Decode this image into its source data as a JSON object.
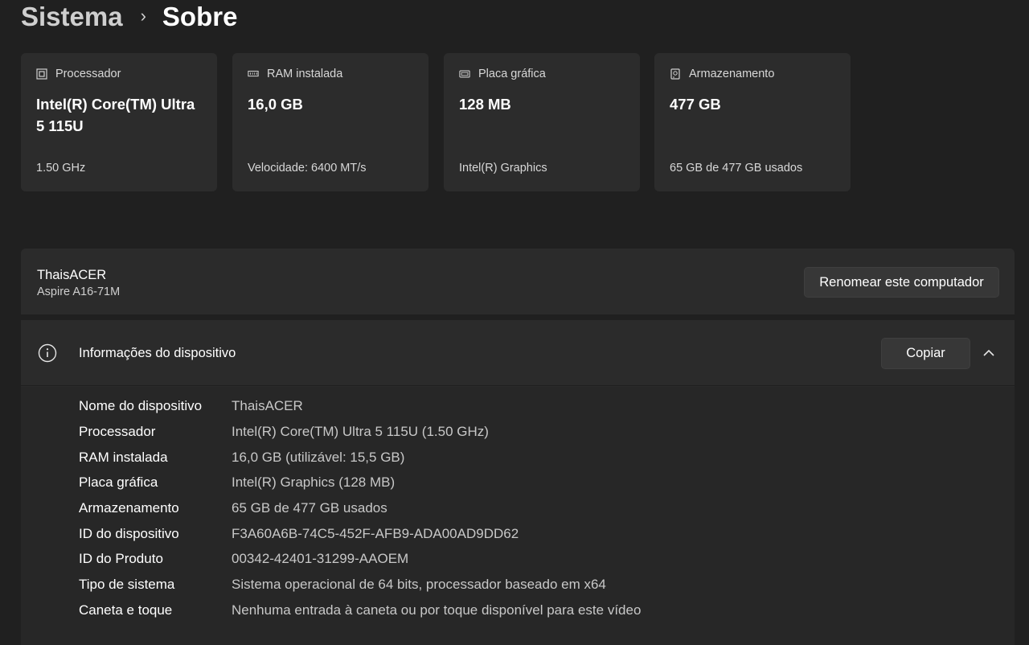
{
  "breadcrumb": {
    "parent": "Sistema",
    "separator": "›",
    "current": "Sobre"
  },
  "cards": [
    {
      "icon": "processor-icon",
      "title": "Processador",
      "value": "Intel(R) Core(TM) Ultra 5 115U",
      "sub": "1.50 GHz"
    },
    {
      "icon": "ram-icon",
      "title": "RAM instalada",
      "value": "16,0 GB",
      "sub": "Velocidade: 6400 MT/s"
    },
    {
      "icon": "graphics-card-icon",
      "title": "Placa gráfica",
      "value": "128 MB",
      "sub": "Intel(R) Graphics"
    },
    {
      "icon": "storage-icon",
      "title": "Armazenamento",
      "value": "477 GB",
      "sub": "65 GB de 477 GB usados"
    }
  ],
  "computer": {
    "name": "ThaisACER",
    "model": "Aspire A16-71M",
    "rename_label": "Renomear este computador"
  },
  "device_info": {
    "title": "Informações do dispositivo",
    "copy_label": "Copiar",
    "rows": [
      {
        "key": "Nome do dispositivo",
        "value": "ThaisACER"
      },
      {
        "key": "Processador",
        "value": "Intel(R) Core(TM) Ultra 5 115U (1.50 GHz)"
      },
      {
        "key": "RAM instalada",
        "value": "16,0 GB (utilizável: 15,5 GB)"
      },
      {
        "key": "Placa gráfica",
        "value": "Intel(R) Graphics (128 MB)"
      },
      {
        "key": "Armazenamento",
        "value": "65 GB de 477 GB usados"
      },
      {
        "key": "ID do dispositivo",
        "value": "F3A60A6B-74C5-452F-AFB9-ADA00AD9DD62"
      },
      {
        "key": "ID do Produto",
        "value": "00342-42401-31299-AAOEM"
      },
      {
        "key": "Tipo de sistema",
        "value": "Sistema operacional de 64 bits, processador baseado em x64"
      },
      {
        "key": "Caneta e toque",
        "value": "Nenhuma entrada à caneta ou por toque disponível para este vídeo"
      }
    ]
  },
  "colors": {
    "background": "#202020",
    "card": "#2c2c2c",
    "panel": "#2b2b2b",
    "button": "#373737"
  }
}
